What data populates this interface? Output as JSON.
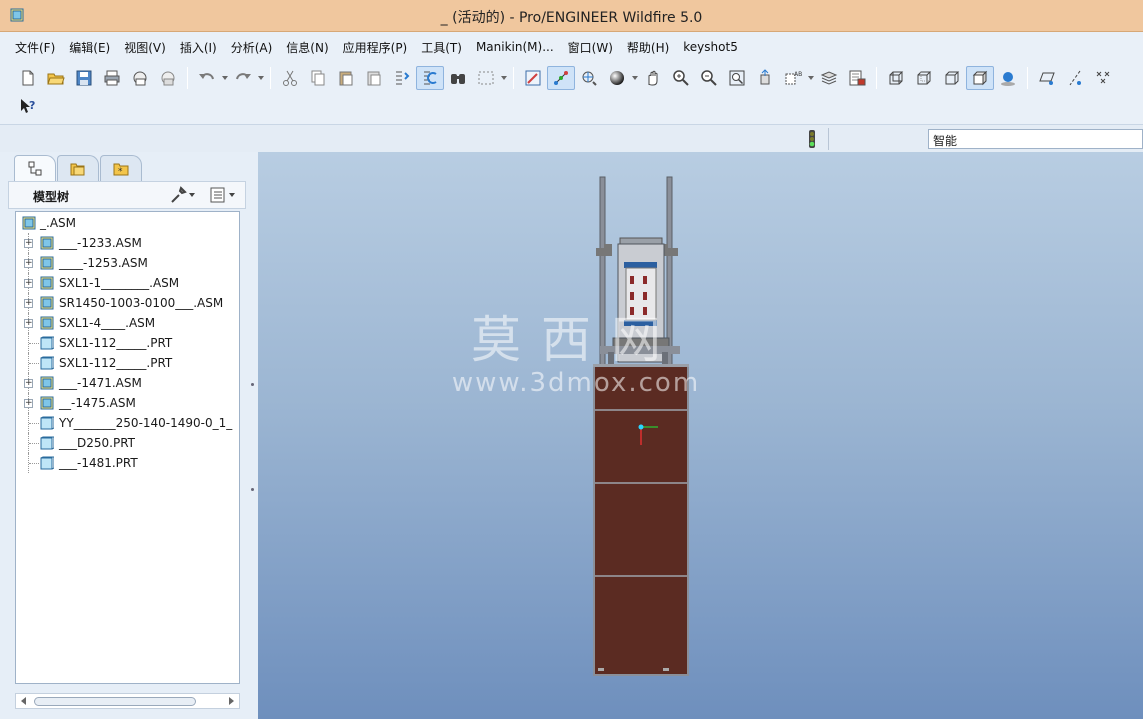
{
  "window": {
    "title": "_ (活动的) - Pro/ENGINEER Wildfire 5.0"
  },
  "menu": {
    "items": [
      "文件(F)",
      "编辑(E)",
      "视图(V)",
      "插入(I)",
      "分析(A)",
      "信息(N)",
      "应用程序(P)",
      "工具(T)",
      "Manikin(M)...",
      "窗口(W)",
      "帮助(H)",
      "keyshot5"
    ]
  },
  "toolbar": {
    "row1": [
      "new-file-icon",
      "open-folder-icon",
      "save-icon",
      "print-icon",
      "email-icon",
      "email-link-icon",
      "undo-icon",
      "redo-icon",
      "cut-icon",
      "copy-icon",
      "paste-icon",
      "paste-special-icon",
      "regenerate-icon",
      "regen-manager-icon",
      "find-icon",
      "select-box-icon",
      "repaint-icon",
      "spin-center-icon",
      "orient-mode-icon",
      "shading-sphere-icon",
      "pan-hand-icon",
      "zoom-in-icon",
      "zoom-out-icon",
      "refit-icon",
      "reorient-icon",
      "saved-views-icon",
      "layers-icon",
      "view-manager-icon",
      "wireframe-icon",
      "hidden-line-icon",
      "no-hidden-icon",
      "shaded-icon",
      "enhanced-realism-icon",
      "datum-planes-icon",
      "datum-axes-icon",
      "datum-points-icon"
    ],
    "row2": [
      "context-help-icon"
    ]
  },
  "status": {
    "filter_value": "智能"
  },
  "model_tree": {
    "header": "模型树",
    "tabs": [
      "model-tree-tab-icon",
      "folder-browser-tab-icon",
      "favorites-tab-icon"
    ],
    "root": "_.ASM",
    "items": [
      {
        "label": "___-1233.ASM",
        "type": "asm",
        "expandable": true
      },
      {
        "label": "____-1253.ASM",
        "type": "asm",
        "expandable": true
      },
      {
        "label": "SXL1-1________.ASM",
        "type": "asm",
        "expandable": true
      },
      {
        "label": "SR1450-1003-0100___.ASM",
        "type": "asm",
        "expandable": true
      },
      {
        "label": "SXL1-4____.ASM",
        "type": "asm",
        "expandable": true
      },
      {
        "label": "SXL1-112_____.PRT",
        "type": "prt",
        "expandable": false
      },
      {
        "label": "SXL1-112_____.PRT",
        "type": "prt",
        "expandable": false
      },
      {
        "label": "___-1471.ASM",
        "type": "asm",
        "expandable": true
      },
      {
        "label": "__-1475.ASM",
        "type": "asm",
        "expandable": true
      },
      {
        "label": "YY_______250-140-1490-0_1_",
        "type": "prt",
        "expandable": false
      },
      {
        "label": "___D250.PRT",
        "type": "prt",
        "expandable": false
      },
      {
        "label": "___-1481.PRT",
        "type": "prt",
        "expandable": false
      }
    ]
  },
  "watermark": {
    "cn": "莫西网",
    "url": "www.3dmox.com"
  },
  "colors": {
    "titlebar": "#f0c79e",
    "chassis": "#5b2b22",
    "viewport_top": "#b8cde2",
    "viewport_bottom": "#6e8fbd"
  }
}
